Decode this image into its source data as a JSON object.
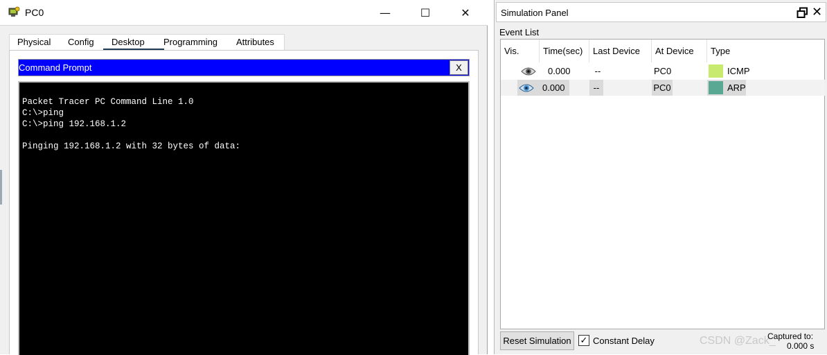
{
  "pc_window": {
    "title": "PC0",
    "controls": {
      "minimize": "—",
      "maximize": "☐",
      "close": "✕"
    },
    "tabs": [
      "Physical",
      "Config",
      "Desktop",
      "Programming",
      "Attributes"
    ],
    "active_tab": "Desktop",
    "command_prompt": {
      "title": "Command Prompt",
      "close_label": "X",
      "lines": [
        "Packet Tracer PC Command Line 1.0",
        "C:\\>ping",
        "C:\\>ping 192.168.1.2",
        "",
        "Pinging 192.168.1.2 with 32 bytes of data:"
      ]
    }
  },
  "simulation_panel": {
    "title": "Simulation Panel",
    "event_list_label": "Event List",
    "columns": [
      "Vis.",
      "Time(sec)",
      "Last Device",
      "At Device",
      "Type"
    ],
    "events": [
      {
        "time": "0.000",
        "last_device": "--",
        "at_device": "PC0",
        "type": "ICMP",
        "color": "#c8ea6e"
      },
      {
        "time": "0.000",
        "last_device": "--",
        "at_device": "PC0",
        "type": "ARP",
        "color": "#58a893"
      }
    ],
    "reset_label": "Reset Simulation",
    "constant_delay_label": "Constant Delay",
    "constant_delay_checked": true,
    "captured_label": "Captured to:",
    "captured_value": "0.000 s",
    "watermark": "CSDN @Zack_"
  },
  "icons": {
    "app_icon": "packet-tracer-pc-icon",
    "eye": "eye-icon",
    "restore": "restore-window-icon"
  }
}
